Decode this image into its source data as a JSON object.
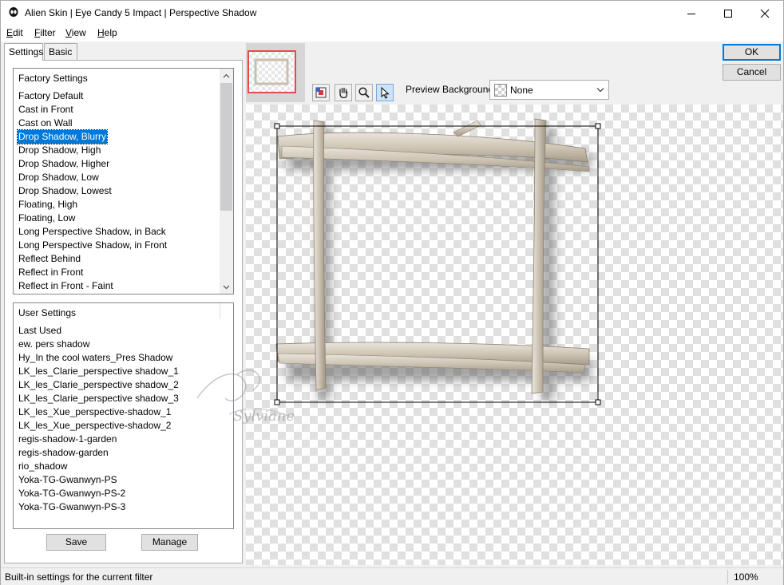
{
  "window": {
    "title": "Alien Skin | Eye Candy 5 Impact | Perspective Shadow",
    "icons": {
      "app": "alien-skin-icon",
      "minimize": "minimize-icon",
      "maximize": "maximize-icon",
      "close": "close-icon"
    }
  },
  "menu": [
    {
      "key": "E",
      "rest": "dit"
    },
    {
      "key": "F",
      "rest": "ilter"
    },
    {
      "key": "V",
      "rest": "iew"
    },
    {
      "key": "H",
      "rest": "elp"
    }
  ],
  "tabs": {
    "settings": "Settings",
    "basic": "Basic"
  },
  "factory": {
    "header": "Factory Settings",
    "items": [
      "Factory Default",
      "Cast in Front",
      "Cast on Wall",
      "Drop Shadow, Blurry",
      "Drop Shadow, High",
      "Drop Shadow, Higher",
      "Drop Shadow, Low",
      "Drop Shadow, Lowest",
      "Floating, High",
      "Floating, Low",
      "Long Perspective Shadow, in Back",
      "Long Perspective Shadow, in Front",
      "Reflect Behind",
      "Reflect in Front",
      "Reflect in Front - Faint"
    ],
    "selected": "Drop Shadow, Blurry"
  },
  "user": {
    "header": "User Settings",
    "items": [
      "Last Used",
      "ew. pers shadow",
      "Hy_In the cool waters_Pres Shadow",
      "LK_les_Clarie_perspective shadow_1",
      "LK_les_Clarie_perspective shadow_2",
      "LK_les_Clarie_perspective shadow_3",
      "LK_les_Xue_perspective-shadow_1",
      "LK_les_Xue_perspective-shadow_2",
      "regis-shadow-1-garden",
      "regis-shadow-garden",
      "rio_shadow",
      "Yoka-TG-Gwanwyn-PS",
      "Yoka-TG-Gwanwyn-PS-2",
      "Yoka-TG-Gwanwyn-PS-3"
    ]
  },
  "buttons": {
    "save": "Save",
    "manage": "Manage",
    "ok": "OK",
    "cancel": "Cancel"
  },
  "toolbar": {
    "tools": [
      "preview-toggle-icon",
      "hand-icon",
      "zoom-icon",
      "arrow-pointer-icon"
    ],
    "active_tool": "arrow-pointer-icon",
    "preview_background_label": "Preview Background:",
    "preview_background_value": "None"
  },
  "watermark": "Sylviane",
  "status": {
    "message": "Built-in settings for the current filter",
    "zoom": "100%"
  }
}
